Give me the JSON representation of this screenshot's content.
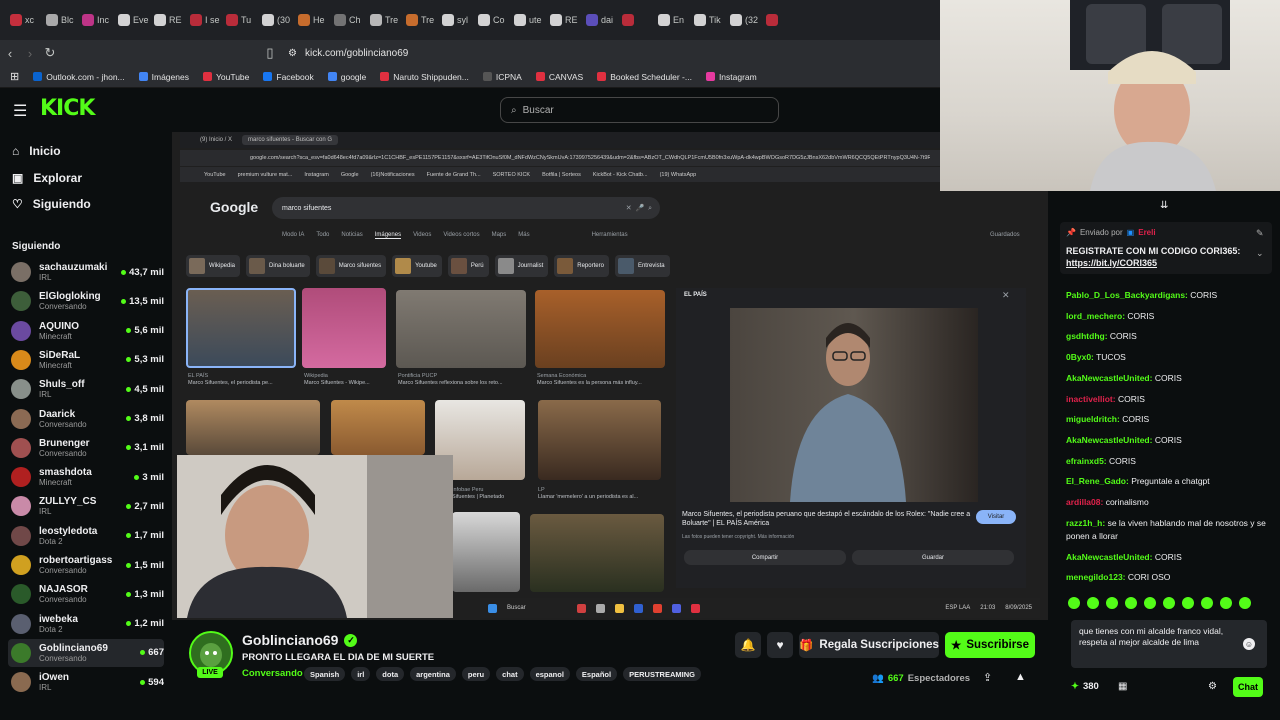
{
  "browser": {
    "tabs": [
      "xc",
      "Blc",
      "Inc",
      "Eve",
      "RE",
      "I se",
      "Tu",
      "(30",
      "He",
      "Ch",
      "Tre",
      "Tre",
      "syl",
      "Co",
      "ute",
      "RE",
      "dai",
      "",
      "En",
      "Tik",
      "(32",
      ""
    ],
    "url": "kick.com/goblinciano69",
    "bookmarks": [
      "Outlook.com - jhon...",
      "Imágenes",
      "YouTube",
      "Facebook",
      "google",
      "Naruto Shippuden...",
      "ICPNA",
      "CANVAS",
      "Booked Scheduler -...",
      "Instagram"
    ]
  },
  "kick": {
    "logo": "KICK",
    "search_placeholder": "Buscar",
    "nav": {
      "home": "Inicio",
      "explore": "Explorar",
      "following": "Siguiendo"
    },
    "following_header": "Siguiendo",
    "channels": [
      {
        "name": "sachauzumaki",
        "category": "IRL",
        "viewers": "43,7 mil",
        "color": "#7a6f66"
      },
      {
        "name": "ElGlogloking",
        "category": "Conversando",
        "viewers": "13,5 mil",
        "color": "#3d5e3a"
      },
      {
        "name": "AQUINO",
        "category": "Minecraft",
        "viewers": "5,6 mil",
        "color": "#6b4aa0"
      },
      {
        "name": "SiDeRaL",
        "category": "Minecraft",
        "viewers": "5,3 mil",
        "color": "#d98a1a"
      },
      {
        "name": "Shuls_off",
        "category": "IRL",
        "viewers": "4,5 mil",
        "color": "#888f8a"
      },
      {
        "name": "Daarick",
        "category": "Conversando",
        "viewers": "3,8 mil",
        "color": "#8b6a53"
      },
      {
        "name": "Brunenger",
        "category": "Conversando",
        "viewers": "3,1 mil",
        "color": "#a05050"
      },
      {
        "name": "smashdota",
        "category": "Minecraft",
        "viewers": "3 mil",
        "color": "#b02020"
      },
      {
        "name": "ZULLYY_CS",
        "category": "IRL",
        "viewers": "2,7 mil",
        "color": "#c98aa8"
      },
      {
        "name": "leostyledota",
        "category": "Dota 2",
        "viewers": "1,7 mil",
        "color": "#704848"
      },
      {
        "name": "robertoartigass",
        "category": "Conversando",
        "viewers": "1,5 mil",
        "color": "#d0a020"
      },
      {
        "name": "NAJASOR",
        "category": "Conversando",
        "viewers": "1,3 mil",
        "color": "#2a5a2a"
      },
      {
        "name": "iwebeka",
        "category": "Dota 2",
        "viewers": "1,2 mil",
        "color": "#5a5f70"
      },
      {
        "name": "Goblinciano69",
        "category": "Conversando",
        "viewers": "667",
        "color": "#3b7a2a"
      },
      {
        "name": "iOwen",
        "category": "IRL",
        "viewers": "594",
        "color": "#8a6a50"
      }
    ]
  },
  "inner_screen": {
    "tabs": [
      "(9) Inicio / X",
      "marco sifuentes - Buscar con G"
    ],
    "url": "google.com/search?sca_esv=fa0d648ec4fd7a09&rlz=1C1CHBF_esPE1157PE1157&sxsrf=AE3TifOnuSf0M_dNFdWzCNySkmUvA:1739975256439&udm=2&fbs=ABzOT_CWdhQLP1FcmU5B0fn3xuWpA-dk4wpBWOGsoR7DG5zJBnsX62dbVmWR6QCQ5QEtPRTnypQ3U4N-7t9R4FDIg3u0jrkD0aPXqwRm4jfSDQ_Ehhv2mk0wGcYnNy6XGfv4lCGuUqpFuCu4sZ3Uv09UalmXSHq6yYyY5gNzeKQ",
    "bookmarks": [
      "YouTube",
      "premium vulture mat...",
      "Instagram",
      "Google",
      "(16)Notificaciones",
      "Fuente de Grand Th...",
      "SORTEO KICK",
      "Botfila | Sorteos",
      "KickBot - Kick Chatb...",
      "(19) WhatsApp"
    ],
    "google_logo": "Google",
    "query": "marco sifuentes",
    "search_tabs": [
      "Modo IA",
      "Todo",
      "Noticias",
      "Imágenes",
      "Videos",
      "Videos cortos",
      "Maps",
      "Más",
      "Herramientas"
    ],
    "saved_label": "Guardados",
    "chips": [
      "Wikipedia",
      "Dina boluarte",
      "Marco sifuentes",
      "Youtube",
      "Perú",
      "Journalist",
      "Reportero",
      "Entrevista"
    ],
    "captions": [
      {
        "src": "EL PAÍS",
        "text": "Marco Sifuentes, el periodista pe..."
      },
      {
        "src": "Wikipedia",
        "text": "Marco Sifuentes - Wikipe..."
      },
      {
        "src": "Pontificia PUCP",
        "text": "Marco Sifuentes reflexiona sobre los reto..."
      },
      {
        "src": "Semana Económica",
        "text": "Marco Sifuentes es la persona más influy..."
      },
      {
        "src": "Infobae Peru",
        "text": "Sifuentes | Planetado"
      },
      {
        "src": "LP",
        "text": "Llamar 'memelero' a un periodista es al..."
      }
    ],
    "preview": {
      "source": "EL PAÍS",
      "title": "Marco Sifuentes, el periodista peruano que destapó el escándalo de los Rolex: \"Nadie cree a Boluarte\" | EL PAÍS América",
      "note": "Las fotos pueden tener copyright. Más información",
      "visit": "Visitar",
      "share": "Compartir",
      "save": "Guardar"
    },
    "taskbar_search": "Buscar",
    "taskbar_lang": "ESP LAA",
    "taskbar_time": "21:03",
    "taskbar_date": "8/09/2025"
  },
  "streamer": {
    "name": "Goblinciano69",
    "live": "LIVE",
    "title": "PRONTO LLEGARA EL DIA DE MI SUERTE",
    "category": "Conversando",
    "tags": [
      "Spanish",
      "irl",
      "dota",
      "argentina",
      "peru",
      "chat",
      "espanol",
      "Español",
      "PERUSTREAMING"
    ],
    "gift_label": "Regala Suscripciones",
    "subscribe_label": "Suscribirse",
    "viewers_count": "667",
    "viewers_label": "Espectadores"
  },
  "chat": {
    "pinned_from_prefix": "Enviado por",
    "pinned_from_user": "Ereli",
    "pinned_text": "REGISTRATE CON MI CODIGO CORI365:",
    "pinned_link": "https://bit.ly/CORI365",
    "messages": [
      {
        "user": "Pablo_D_Los_Backyardigans:",
        "text": " CORIS",
        "color": "#53fc18"
      },
      {
        "user": "lord_mechero:",
        "text": " CORIS",
        "color": "#53fc18"
      },
      {
        "user": "gsdhtdhg:",
        "text": " CORIS",
        "color": "#53fc18"
      },
      {
        "user": "0Byx0:",
        "text": " TUCOS",
        "color": "#53fc18"
      },
      {
        "user": "AkaNewcastleUnited:",
        "text": " CORIS",
        "color": "#53fc18"
      },
      {
        "user": "inactivelliot:",
        "text": " CORIS",
        "color": "#e0224b"
      },
      {
        "user": "migueldritch:",
        "text": " CORIS",
        "color": "#53fc18"
      },
      {
        "user": "AkaNewcastleUnited:",
        "text": " CORIS",
        "color": "#53fc18"
      },
      {
        "user": "efrainxd5:",
        "text": " CORIS",
        "color": "#53fc18"
      },
      {
        "user": "El_Rene_Gado:",
        "text": " Preguntale a chatgpt",
        "color": "#53fc18"
      },
      {
        "user": "ardilla08:",
        "text": " corinalismo",
        "color": "#e0224b"
      },
      {
        "user": "razz1h_h:",
        "text": " se la viven hablando mal de nosotros y se ponen a llorar",
        "color": "#53fc18"
      },
      {
        "user": "AkaNewcastleUnited:",
        "text": " CORIS",
        "color": "#53fc18"
      },
      {
        "user": "menegildo123:",
        "text": " CORI OSO",
        "color": "#53fc18"
      }
    ],
    "input_text": "que tienes con mi alcalde franco vidal, respeta al mejor alcalde de lima",
    "points": "380",
    "chat_button": "Chat"
  },
  "colors": {
    "kick_green": "#53fc18",
    "bg": "#0b0e0f"
  }
}
